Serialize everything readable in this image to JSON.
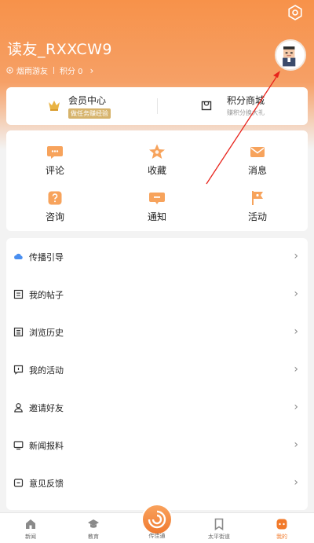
{
  "profile": {
    "username": "读友_RXXCW9",
    "level": "烟雨游友",
    "points": "积分 0",
    "chevron": "›"
  },
  "vip": {
    "member_title": "会员中心",
    "member_badge": "做任务赚经验",
    "mall_title": "积分商城",
    "mall_sub": "赚积分换大礼"
  },
  "grid": [
    {
      "label": "评论",
      "icon": "comment-icon"
    },
    {
      "label": "收藏",
      "icon": "star-icon"
    },
    {
      "label": "消息",
      "icon": "mail-icon"
    },
    {
      "label": "咨询",
      "icon": "question-icon"
    },
    {
      "label": "通知",
      "icon": "notice-icon"
    },
    {
      "label": "活动",
      "icon": "flag-icon"
    }
  ],
  "list": [
    {
      "label": "传播引导",
      "icon": "cloud-icon"
    },
    {
      "label": "我的帖子",
      "icon": "post-icon"
    },
    {
      "label": "浏览历史",
      "icon": "history-icon"
    },
    {
      "label": "我的活动",
      "icon": "activity-icon"
    },
    {
      "label": "邀请好友",
      "icon": "user-icon"
    },
    {
      "label": "新闻报料",
      "icon": "screen-icon"
    },
    {
      "label": "意见反馈",
      "icon": "feedback-icon"
    }
  ],
  "list_arrow": "›",
  "tabs": [
    {
      "label": "新闻",
      "icon": "home-icon"
    },
    {
      "label": "教育",
      "icon": "graduation-icon"
    },
    {
      "label": "传佳通",
      "icon": "center-logo-icon"
    },
    {
      "label": "太平街道",
      "icon": "bookmark-icon"
    },
    {
      "label": "我的",
      "icon": "profile-icon"
    }
  ],
  "colors": {
    "accent": "#f27a2a",
    "header_top": "#f7924a",
    "gold": "#d6b36b",
    "annotation_arrow": "#e8241c"
  }
}
